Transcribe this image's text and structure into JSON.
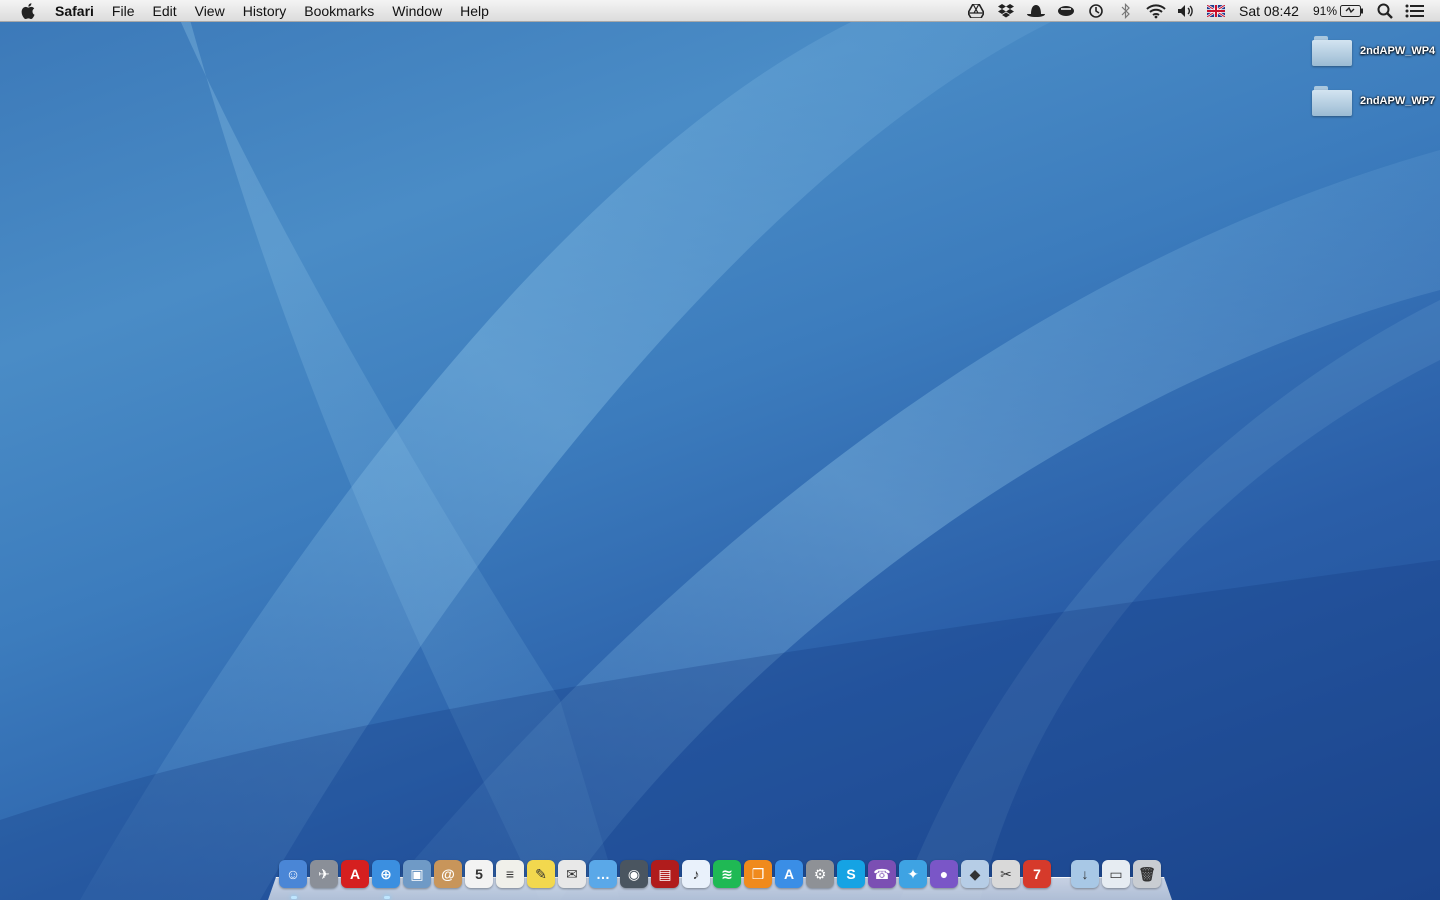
{
  "menubar": {
    "app_name": "Safari",
    "menus": [
      "File",
      "Edit",
      "View",
      "History",
      "Bookmarks",
      "Window",
      "Help"
    ],
    "status_icons": [
      "google-drive-icon",
      "dropbox-icon",
      "hat-icon",
      "coffee-icon",
      "time-machine-icon",
      "bluetooth-icon",
      "wifi-icon",
      "volume-icon",
      "uk-flag-icon"
    ],
    "clock": "Sat 08:42",
    "battery_percent": "91%"
  },
  "desktop": {
    "icons": [
      {
        "label": "2ndAPW_WP4"
      },
      {
        "label": "2ndAPW_WP7"
      }
    ]
  },
  "dock": {
    "apps": [
      {
        "name": "finder-icon",
        "color": "#4a86d6",
        "glyph": "☺"
      },
      {
        "name": "launchpad-icon",
        "color": "#8a8f98",
        "glyph": "✈"
      },
      {
        "name": "acrobat-icon",
        "color": "#d51f1f",
        "glyph": "A"
      },
      {
        "name": "safari-icon",
        "color": "#3b8fe0",
        "glyph": "⊕"
      },
      {
        "name": "preview-icon",
        "color": "#6f9ac6",
        "glyph": "▣"
      },
      {
        "name": "contacts-icon",
        "color": "#c8955a",
        "glyph": "@"
      },
      {
        "name": "calendar-icon",
        "color": "#f3f3f3",
        "glyph": "5"
      },
      {
        "name": "textedit-icon",
        "color": "#f0f0ea",
        "glyph": "≡"
      },
      {
        "name": "notes-icon",
        "color": "#f2d84e",
        "glyph": "✎"
      },
      {
        "name": "mail-icon",
        "color": "#e8e8e8",
        "glyph": "✉"
      },
      {
        "name": "messages-icon",
        "color": "#5aa8e8",
        "glyph": "…"
      },
      {
        "name": "facetime-icon",
        "color": "#4a5560",
        "glyph": "◉"
      },
      {
        "name": "photo-booth-icon",
        "color": "#b01c1c",
        "glyph": "▤"
      },
      {
        "name": "itunes-icon",
        "color": "#e9f1fb",
        "glyph": "♪"
      },
      {
        "name": "spotify-icon",
        "color": "#1fb954",
        "glyph": "≋"
      },
      {
        "name": "ibooks-icon",
        "color": "#f08a1c",
        "glyph": "❒"
      },
      {
        "name": "app-store-icon",
        "color": "#3a8ee6",
        "glyph": "A"
      },
      {
        "name": "system-preferences-icon",
        "color": "#8e9196",
        "glyph": "⚙"
      },
      {
        "name": "skype-icon",
        "color": "#15a3e4",
        "glyph": "S"
      },
      {
        "name": "viber-icon",
        "color": "#7b4fb3",
        "glyph": "☎"
      },
      {
        "name": "twitter-icon",
        "color": "#3ea3e3",
        "glyph": "✦"
      },
      {
        "name": "orb-icon",
        "color": "#7a56c7",
        "glyph": "●"
      },
      {
        "name": "box-icon",
        "color": "#b6cde6",
        "glyph": "◆"
      },
      {
        "name": "script-editor-icon",
        "color": "#d9d9d9",
        "glyph": "✂"
      },
      {
        "name": "fantastical-icon",
        "color": "#d63a2b",
        "glyph": "7"
      }
    ],
    "right_items": [
      {
        "name": "downloads-folder-icon",
        "color": "#a8c8e6",
        "glyph": "↓"
      },
      {
        "name": "screen-sharing-icon",
        "color": "#e6ecf2",
        "glyph": "▭"
      },
      {
        "name": "trash-icon",
        "color": "#c9cdd2",
        "glyph": "🗑"
      }
    ]
  }
}
